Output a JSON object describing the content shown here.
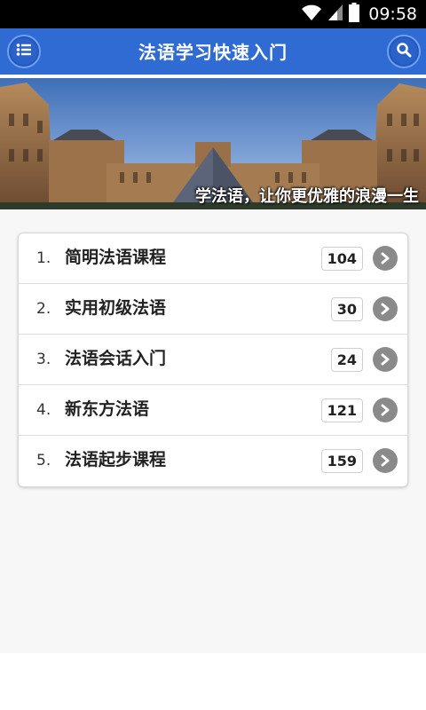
{
  "status_bar": {
    "time": "09:58",
    "icons": [
      "wifi-icon",
      "signal-icon",
      "battery-icon"
    ]
  },
  "app_bar": {
    "title": "法语学习快速入门",
    "menu_icon": "list-icon",
    "search_icon": "search-icon",
    "color": "#2f6bd3"
  },
  "banner": {
    "caption": "学法语，让你更优雅的浪漫一生"
  },
  "lessons": [
    {
      "number": "1.",
      "label": "简明法语课程",
      "count": "104"
    },
    {
      "number": "2.",
      "label": "实用初级法语",
      "count": "30"
    },
    {
      "number": "3.",
      "label": "法语会话入门",
      "count": "24"
    },
    {
      "number": "4.",
      "label": "新东方法语",
      "count": "121"
    },
    {
      "number": "5.",
      "label": "法语起步课程",
      "count": "159"
    }
  ]
}
